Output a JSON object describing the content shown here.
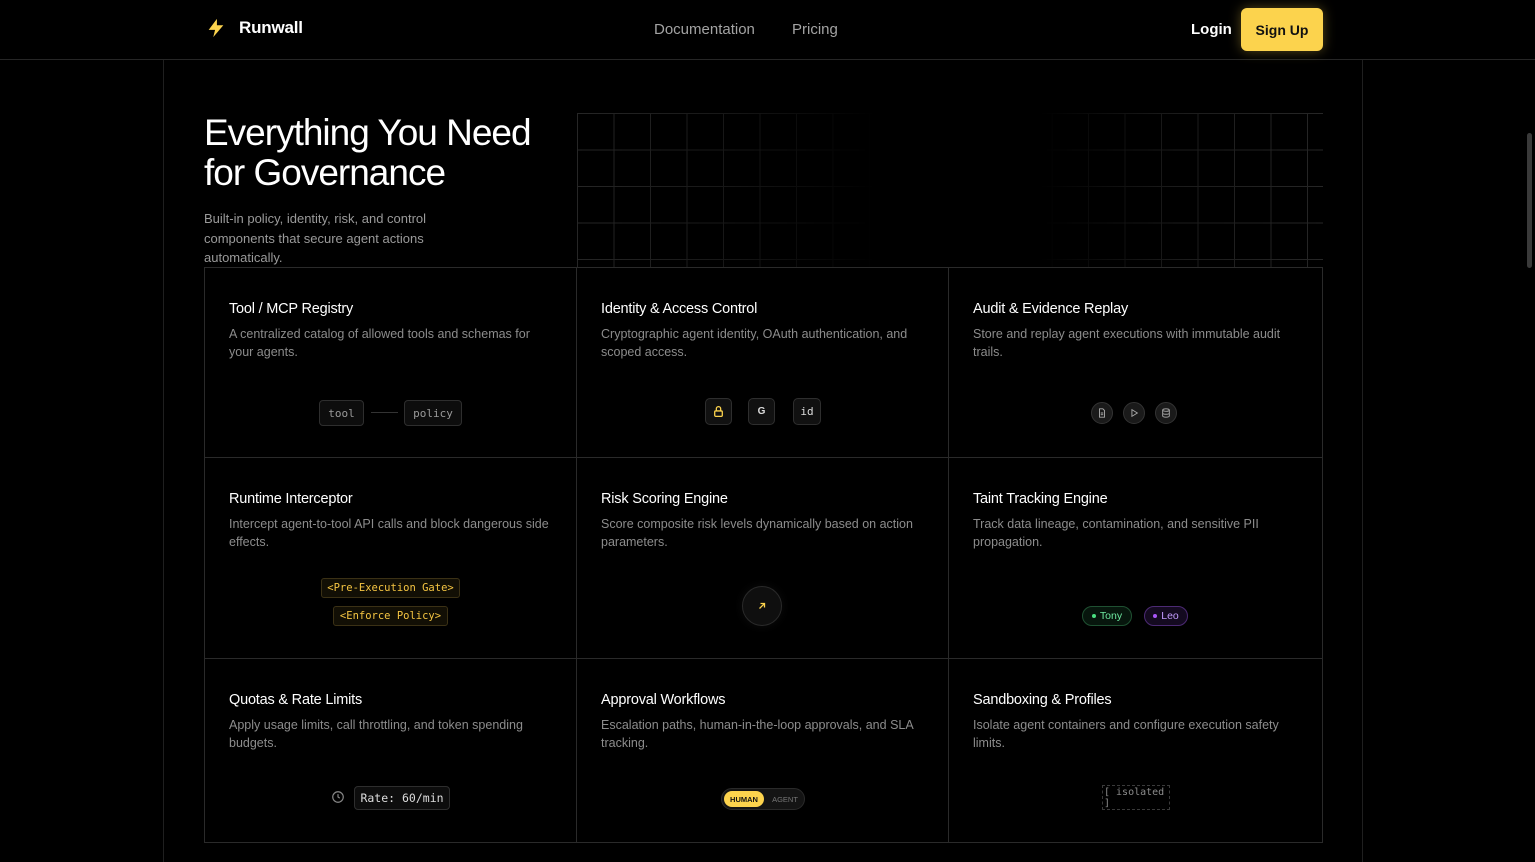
{
  "nav": {
    "brand": "Runwall",
    "links": [
      "Documentation",
      "Pricing"
    ],
    "login": "Login",
    "signup": "Sign Up"
  },
  "hero": {
    "title_line1": "Everything You Need",
    "title_line2": "for Governance",
    "subtitle": "Built-in policy, identity, risk, and control components that secure agent actions automatically."
  },
  "colors": {
    "accent": "#fcd34d",
    "green": "#4ade80",
    "purple": "#a855f7"
  },
  "features": [
    {
      "title": "Tool / MCP Registry",
      "desc": "A centralized catalog of allowed tools and schemas for your agents.",
      "chips": [
        "tool",
        "policy"
      ]
    },
    {
      "title": "Identity & Access Control",
      "desc": "Cryptographic agent identity, OAuth authentication, and scoped access.",
      "icons": [
        "lock-icon",
        "G",
        "id"
      ]
    },
    {
      "title": "Audit & Evidence Replay",
      "desc": "Store and replay agent executions with immutable audit trails.",
      "icons": [
        "file-icon",
        "play-icon",
        "database-icon"
      ]
    },
    {
      "title": "Runtime Interceptor",
      "desc": "Intercept agent-to-tool API calls and block dangerous side effects.",
      "tags": [
        "<Pre-Execution Gate>",
        "<Enforce Policy>"
      ]
    },
    {
      "title": "Risk Scoring Engine",
      "desc": "Score composite risk levels dynamically based on action parameters.",
      "icon": "arrow-up-right-icon"
    },
    {
      "title": "Taint Tracking Engine",
      "desc": "Track data lineage, contamination, and sensitive PII propagation.",
      "pills": [
        "Tony",
        "Leo"
      ]
    },
    {
      "title": "Quotas & Rate Limits",
      "desc": "Apply usage limits, call throttling, and token spending budgets.",
      "rate": "Rate: 60/min",
      "icon": "clock-icon"
    },
    {
      "title": "Approval Workflows",
      "desc": "Escalation paths, human-in-the-loop approvals, and SLA tracking.",
      "toggle": [
        "HUMAN",
        "AGENT"
      ]
    },
    {
      "title": "Sandboxing & Profiles",
      "desc": "Isolate agent containers and configure execution safety limits.",
      "box": "[ isolated ]"
    }
  ]
}
